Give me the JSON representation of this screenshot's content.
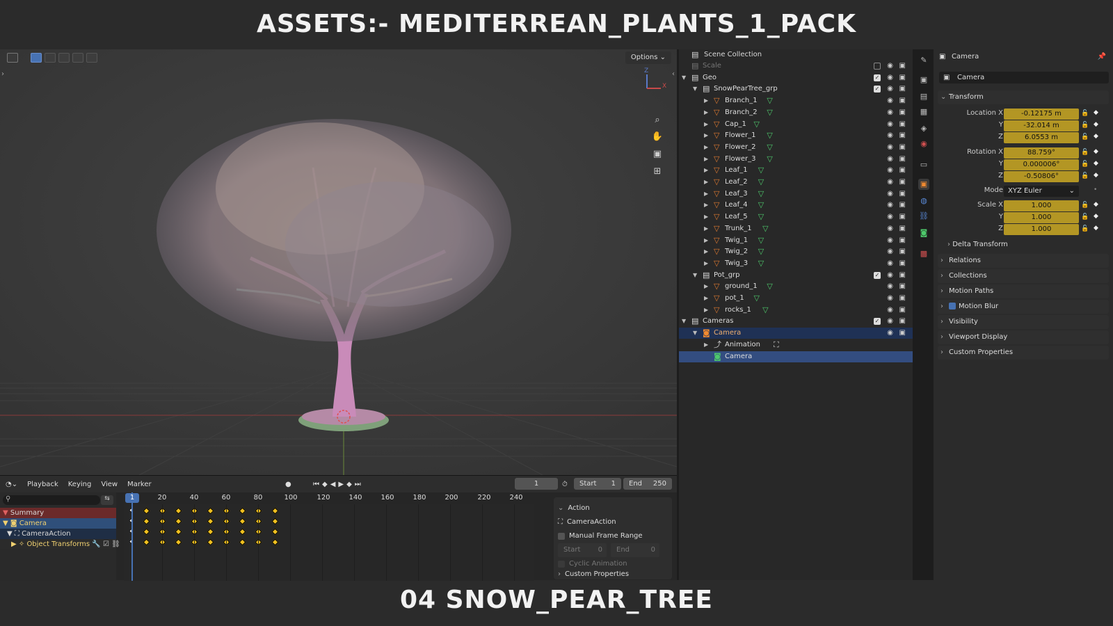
{
  "banner_top": "ASSETS:- MEDITERREAN_PLANTS_1_PACK",
  "banner_bottom": "04 SNOW_PEAR_TREE",
  "viewport": {
    "options_label": "Options",
    "tool_icons": [
      "zoom-icon",
      "hand-icon",
      "camera-view-icon",
      "grid-icon"
    ]
  },
  "timeline": {
    "menus": [
      "Playback",
      "Keying",
      "View",
      "Marker"
    ],
    "current_frame": "1",
    "start_label": "Start",
    "start_value": "1",
    "end_label": "End",
    "end_value": "250",
    "ruler_ticks": [
      "20",
      "40",
      "60",
      "80",
      "100",
      "120",
      "140",
      "160",
      "180",
      "200",
      "220",
      "240"
    ],
    "playhead_frame": "1",
    "channels": [
      "Summary",
      "Camera",
      "CameraAction",
      "Object Transforms"
    ],
    "action_panel": {
      "title": "Action",
      "action_name": "CameraAction",
      "manual_frame_range": "Manual Frame Range",
      "start_label": "Start",
      "start_value": "0",
      "end_label": "End",
      "end_value": "0",
      "cyclic": "Cyclic Animation",
      "custom_props": "Custom Properties"
    }
  },
  "outliner": {
    "root": "Scene Collection",
    "items": [
      {
        "label": "Scale",
        "depth": 0,
        "kind": "collection",
        "dim": true
      },
      {
        "label": "Geo",
        "depth": 0,
        "kind": "collection",
        "arrow": "down"
      },
      {
        "label": "SnowPearTree_grp",
        "depth": 1,
        "kind": "collection",
        "arrow": "down"
      },
      {
        "label": "Branch_1",
        "depth": 2,
        "kind": "mesh"
      },
      {
        "label": "Branch_2",
        "depth": 2,
        "kind": "mesh"
      },
      {
        "label": "Cap_1",
        "depth": 2,
        "kind": "mesh"
      },
      {
        "label": "Flower_1",
        "depth": 2,
        "kind": "mesh"
      },
      {
        "label": "Flower_2",
        "depth": 2,
        "kind": "mesh"
      },
      {
        "label": "Flower_3",
        "depth": 2,
        "kind": "mesh"
      },
      {
        "label": "Leaf_1",
        "depth": 2,
        "kind": "mesh"
      },
      {
        "label": "Leaf_2",
        "depth": 2,
        "kind": "mesh"
      },
      {
        "label": "Leaf_3",
        "depth": 2,
        "kind": "mesh"
      },
      {
        "label": "Leaf_4",
        "depth": 2,
        "kind": "mesh"
      },
      {
        "label": "Leaf_5",
        "depth": 2,
        "kind": "mesh"
      },
      {
        "label": "Trunk_1",
        "depth": 2,
        "kind": "mesh"
      },
      {
        "label": "Twig_1",
        "depth": 2,
        "kind": "mesh"
      },
      {
        "label": "Twig_2",
        "depth": 2,
        "kind": "mesh"
      },
      {
        "label": "Twig_3",
        "depth": 2,
        "kind": "mesh"
      },
      {
        "label": "Pot_grp",
        "depth": 1,
        "kind": "collection",
        "arrow": "down"
      },
      {
        "label": "ground_1",
        "depth": 2,
        "kind": "mesh"
      },
      {
        "label": "pot_1",
        "depth": 2,
        "kind": "mesh"
      },
      {
        "label": "rocks_1",
        "depth": 2,
        "kind": "mesh"
      },
      {
        "label": "Cameras",
        "depth": 0,
        "kind": "collection",
        "arrow": "down"
      },
      {
        "label": "Camera",
        "depth": 1,
        "kind": "camera-object",
        "arrow": "down",
        "highlight": true
      },
      {
        "label": "Animation",
        "depth": 2,
        "kind": "animation"
      },
      {
        "label": "Camera",
        "depth": 2,
        "kind": "camera-data",
        "selected": true
      }
    ]
  },
  "properties": {
    "title": "Camera",
    "object_name": "Camera",
    "transform_label": "Transform",
    "location": {
      "label_x": "Location X",
      "x": "-0.12175 m",
      "y": "-32.014 m",
      "z": "6.0553 m"
    },
    "rotation": {
      "label_x": "Rotation X",
      "x": "88.759°",
      "y": "0.000006°",
      "z": "-0.50806°"
    },
    "mode_label": "Mode",
    "mode_value": "XYZ Euler",
    "scale": {
      "label_x": "Scale X",
      "x": "1.000",
      "y": "1.000",
      "z": "1.000"
    },
    "axis_y": "Y",
    "axis_z": "Z",
    "delta": "Delta Transform",
    "panels": [
      "Relations",
      "Collections",
      "Motion Paths",
      "Motion Blur",
      "Visibility",
      "Viewport Display",
      "Custom Properties"
    ]
  },
  "colors": {
    "selection_blue": "#4772b3",
    "keyframe_yellow": "#f0c020",
    "animated_field": "#b39624",
    "mesh_orange": "#e07a30",
    "modifier_green": "#4ec96b"
  }
}
